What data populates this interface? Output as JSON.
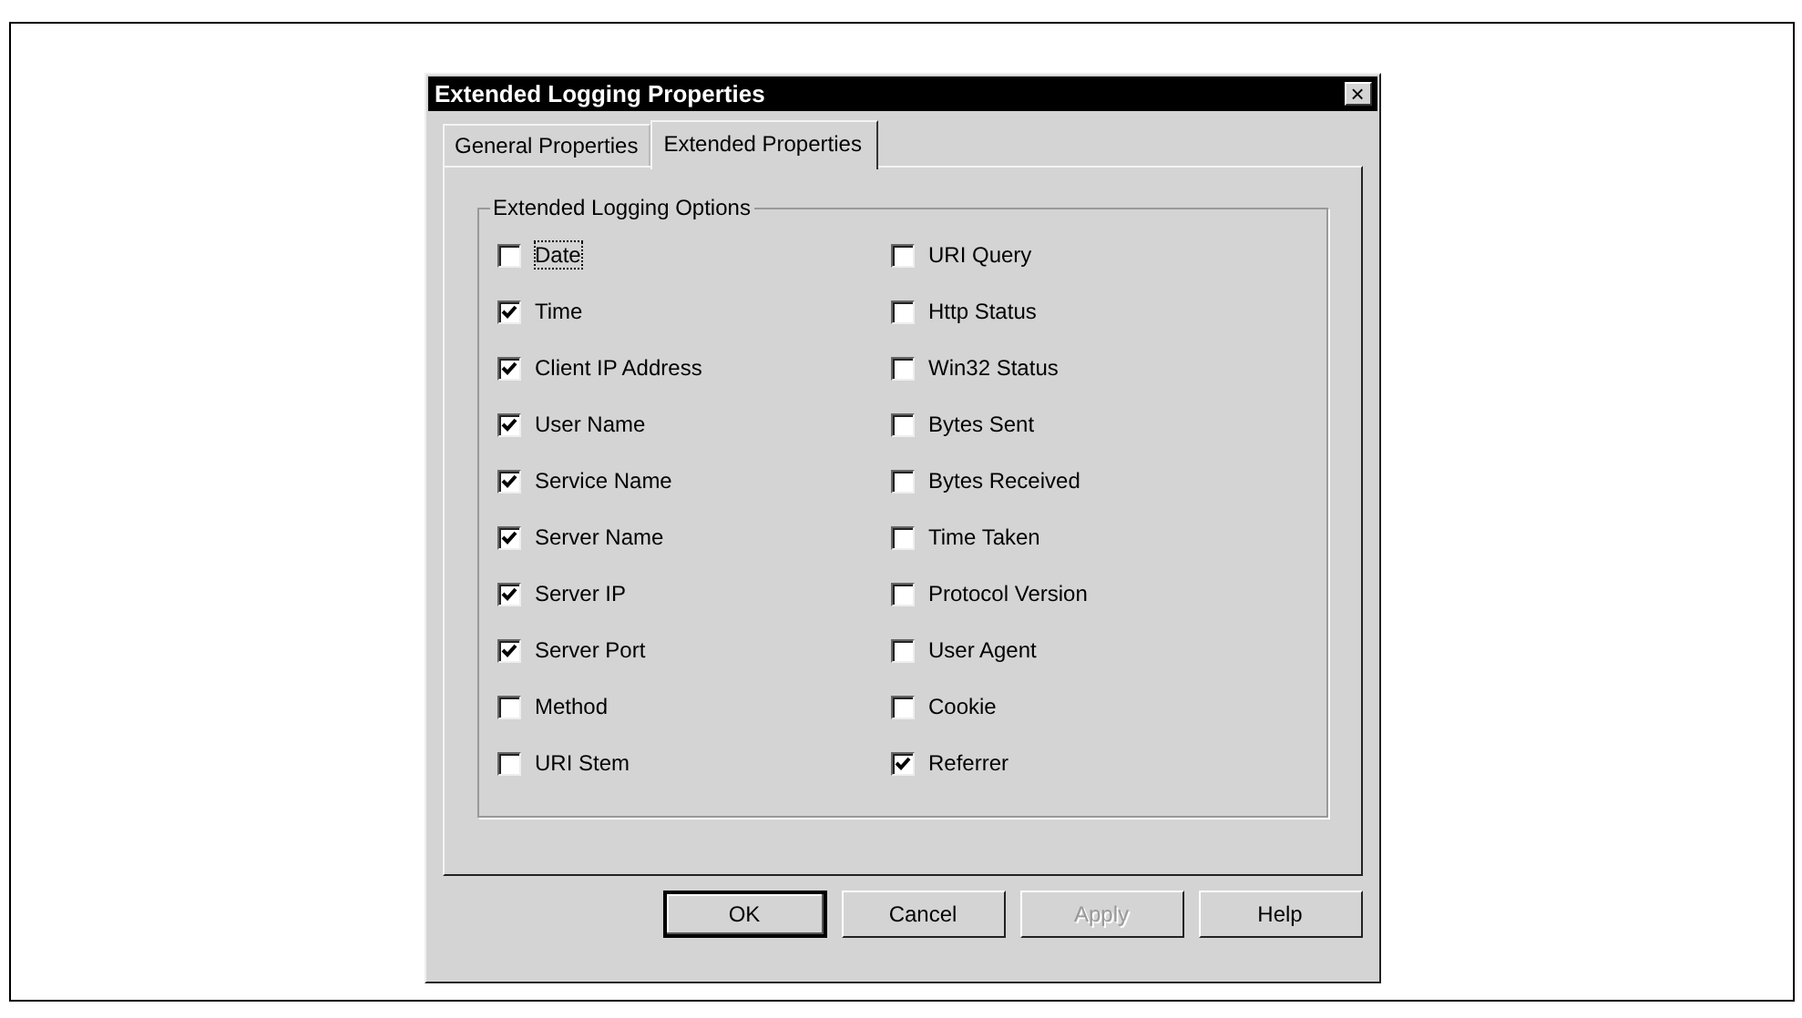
{
  "window": {
    "title": "Extended Logging Properties",
    "close": "×"
  },
  "tabs": [
    {
      "label": "General Properties",
      "selected": false
    },
    {
      "label": "Extended Properties",
      "selected": true
    }
  ],
  "group": {
    "title": "Extended Logging Options"
  },
  "options": [
    {
      "label": "Date",
      "checked": false,
      "focused": true
    },
    {
      "label": "URI Query",
      "checked": false,
      "focused": false
    },
    {
      "label": "Time",
      "checked": true,
      "focused": false
    },
    {
      "label": "Http Status",
      "checked": false,
      "focused": false
    },
    {
      "label": "Client IP Address",
      "checked": true,
      "focused": false
    },
    {
      "label": "Win32 Status",
      "checked": false,
      "focused": false
    },
    {
      "label": "User Name",
      "checked": true,
      "focused": false
    },
    {
      "label": "Bytes Sent",
      "checked": false,
      "focused": false
    },
    {
      "label": "Service Name",
      "checked": true,
      "focused": false
    },
    {
      "label": "Bytes Received",
      "checked": false,
      "focused": false
    },
    {
      "label": "Server Name",
      "checked": true,
      "focused": false
    },
    {
      "label": "Time Taken",
      "checked": false,
      "focused": false
    },
    {
      "label": "Server IP",
      "checked": true,
      "focused": false
    },
    {
      "label": "Protocol Version",
      "checked": false,
      "focused": false
    },
    {
      "label": "Server Port",
      "checked": true,
      "focused": false
    },
    {
      "label": "User Agent",
      "checked": false,
      "focused": false
    },
    {
      "label": "Method",
      "checked": false,
      "focused": false
    },
    {
      "label": "Cookie",
      "checked": false,
      "focused": false
    },
    {
      "label": "URI Stem",
      "checked": false,
      "focused": false
    },
    {
      "label": "Referrer",
      "checked": true,
      "focused": false
    }
  ],
  "buttons": [
    {
      "label": "OK",
      "default": true,
      "disabled": false
    },
    {
      "label": "Cancel",
      "default": false,
      "disabled": false
    },
    {
      "label": "Apply",
      "default": false,
      "disabled": true
    },
    {
      "label": "Help",
      "default": false,
      "disabled": false
    }
  ]
}
